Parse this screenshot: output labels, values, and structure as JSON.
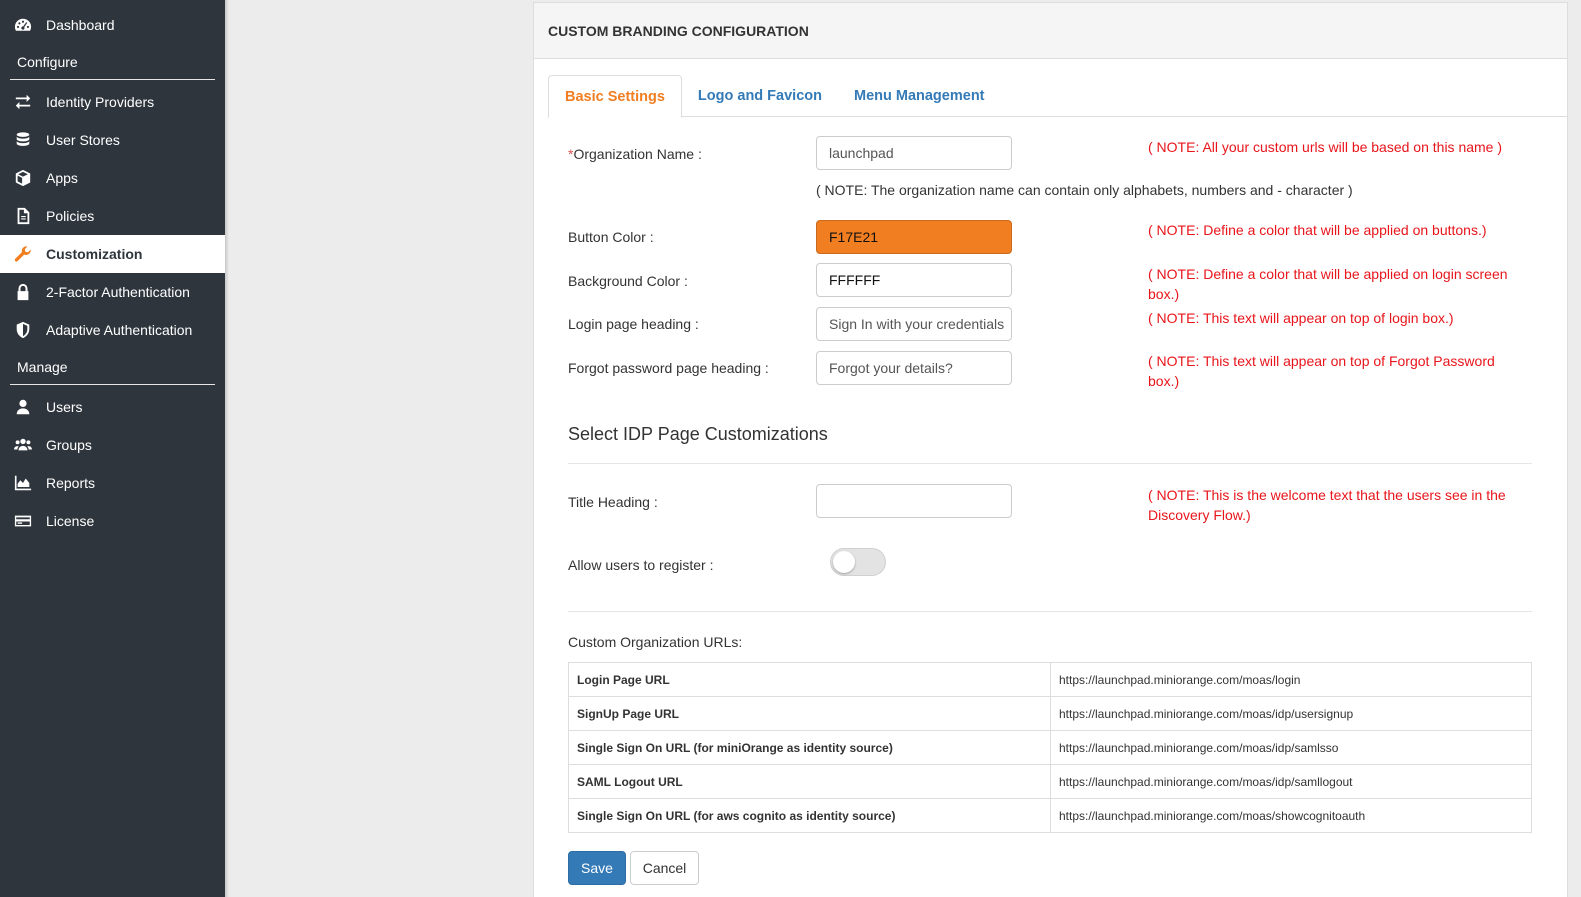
{
  "sidebar": {
    "items": [
      {
        "label": "Dashboard",
        "icon": "dashboard-icon"
      },
      {
        "section": "Configure"
      },
      {
        "label": "Identity Providers",
        "icon": "exchange-arrows-icon"
      },
      {
        "label": "User Stores",
        "icon": "database-icon"
      },
      {
        "label": "Apps",
        "icon": "cube-icon"
      },
      {
        "label": "Policies",
        "icon": "document-icon"
      },
      {
        "label": "Customization",
        "icon": "wrench-icon",
        "active": true
      },
      {
        "label": "2-Factor Authentication",
        "icon": "lock-icon"
      },
      {
        "label": "Adaptive Authentication",
        "icon": "shield-icon"
      },
      {
        "section": "Manage"
      },
      {
        "label": "Users",
        "icon": "user-icon"
      },
      {
        "label": "Groups",
        "icon": "group-icon"
      },
      {
        "label": "Reports",
        "icon": "area-chart-icon"
      },
      {
        "label": "License",
        "icon": "credit-card-icon"
      }
    ],
    "labels": {
      "dashboard": "Dashboard",
      "configure": "Configure",
      "identity_providers": "Identity Providers",
      "user_stores": "User Stores",
      "apps": "Apps",
      "policies": "Policies",
      "customization": "Customization",
      "two_factor": "2-Factor Authentication",
      "adaptive": "Adaptive Authentication",
      "manage": "Manage",
      "users": "Users",
      "groups": "Groups",
      "reports": "Reports",
      "license": "License"
    }
  },
  "panel": {
    "title": "CUSTOM BRANDING CONFIGURATION",
    "tabs": [
      {
        "label": "Basic Settings",
        "active": true
      },
      {
        "label": "Logo and Favicon"
      },
      {
        "label": "Menu Management"
      }
    ]
  },
  "form": {
    "org_name": {
      "required_mark": "*",
      "label": "Organization Name :",
      "value": "launchpad",
      "note": "( NOTE: All your custom urls will be based on this name )",
      "subnote": "( NOTE: The organization name can contain only alphabets, numbers and - character )"
    },
    "button_color": {
      "label": "Button Color :",
      "value": "F17E21",
      "swatch": "#F17E21",
      "note": "( NOTE: Define a color that will be applied on buttons.)"
    },
    "background_color": {
      "label": "Background Color :",
      "value": "FFFFFF",
      "swatch": "#FFFFFF",
      "note": "( NOTE: Define a color that will be applied on login screen box.)"
    },
    "login_heading": {
      "label": "Login page heading :",
      "value": "Sign In with your credentials",
      "note": "( NOTE: This text will appear on top of login box.)"
    },
    "forgot_heading": {
      "label": "Forgot password page heading :",
      "value": "Forgot your details?",
      "note": "( NOTE: This text will appear on top of Forgot Password box.)"
    },
    "idp_section_title": "Select IDP Page Customizations",
    "title_heading": {
      "label": "Title Heading :",
      "value": "",
      "note": "( NOTE: This is the welcome text that the users see in the Discovery Flow.)"
    },
    "allow_register": {
      "label": "Allow users to register :",
      "enabled": false
    },
    "urls_label": "Custom Organization URLs:",
    "urls": [
      {
        "name": "Login Page URL",
        "url": "https://launchpad.miniorange.com/moas/login"
      },
      {
        "name": "SignUp Page URL",
        "url": "https://launchpad.miniorange.com/moas/idp/usersignup"
      },
      {
        "name": "Single Sign On URL (for miniOrange as identity source)",
        "url": "https://launchpad.miniorange.com/moas/idp/samlsso"
      },
      {
        "name": "SAML Logout URL",
        "url": "https://launchpad.miniorange.com/moas/idp/samllogout"
      },
      {
        "name": "Single Sign On URL (for aws cognito as identity source)",
        "url": "https://launchpad.miniorange.com/moas/showcognitoauth"
      }
    ],
    "save_label": "Save",
    "cancel_label": "Cancel"
  },
  "colors": {
    "accent": "#f17e21",
    "link": "#337ab7",
    "sidebar_bg": "#2e353d",
    "note_red": "#e8151b"
  }
}
